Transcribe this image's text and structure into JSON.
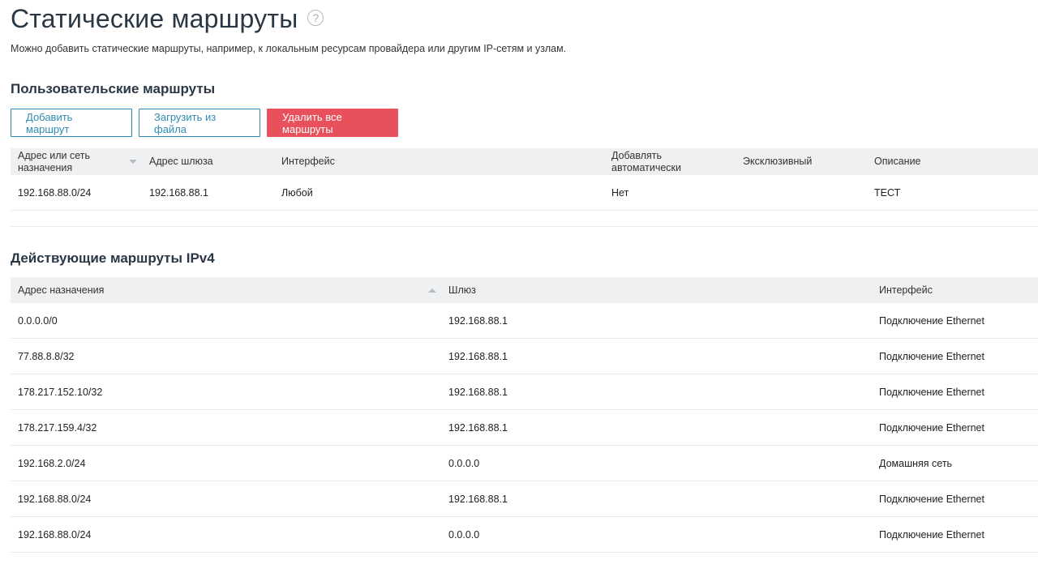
{
  "page": {
    "title": "Статические маршруты",
    "subtitle": "Можно добавить статические маршруты, например, к локальным ресурсам провайдера или другим IP-сетям и узлам."
  },
  "custom": {
    "title": "Пользовательские маршруты",
    "buttons": {
      "add": "Добавить маршрут",
      "load": "Загрузить из файла",
      "delete_all": "Удалить все маршруты"
    },
    "headers": [
      "Адрес или сеть назначения",
      "Адрес шлюза",
      "Интерфейс",
      "Добавлять автоматически",
      "Эксклюзивный",
      "Описание"
    ],
    "rows": [
      [
        "192.168.88.0/24",
        "192.168.88.1",
        "Любой",
        "Нет",
        "",
        "ТЕСТ"
      ]
    ]
  },
  "active": {
    "title": "Действующие маршруты IPv4",
    "headers": [
      "Адрес назначения",
      "Шлюз",
      "Интерфейс"
    ],
    "rows": [
      [
        "0.0.0.0/0",
        "192.168.88.1",
        "Подключение Ethernet"
      ],
      [
        "77.88.8.8/32",
        "192.168.88.1",
        "Подключение Ethernet"
      ],
      [
        "178.217.152.10/32",
        "192.168.88.1",
        "Подключение Ethernet"
      ],
      [
        "178.217.159.4/32",
        "192.168.88.1",
        "Подключение Ethernet"
      ],
      [
        "192.168.2.0/24",
        "0.0.0.0",
        "Домашняя сеть"
      ],
      [
        "192.168.88.0/24",
        "192.168.88.1",
        "Подключение Ethernet"
      ],
      [
        "192.168.88.0/24",
        "0.0.0.0",
        "Подключение Ethernet"
      ]
    ]
  },
  "colors": {
    "accent": "#2f8bb5",
    "danger": "#e8505b",
    "header_bg": "#eef0f2"
  }
}
